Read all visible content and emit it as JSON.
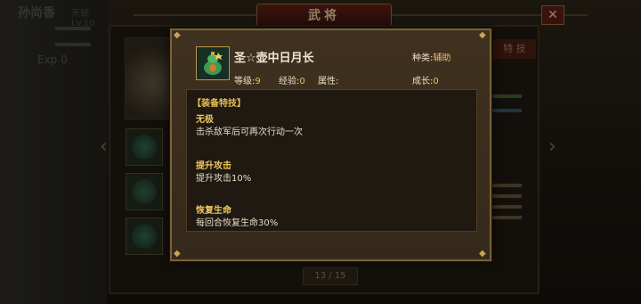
{
  "background": {
    "hero_name": "孙尚香",
    "hero_sub": "天赋 Lv.10",
    "exp_label": "Exp 0",
    "window_title": "武将",
    "close_glyph": "✕",
    "right_tab_label": "特 技",
    "page_indicator": "13 / 15",
    "arrow_left": "‹",
    "arrow_right": "›"
  },
  "popup": {
    "item_name": "圣☆壶中日月长",
    "item_icon": "gourd-icon",
    "level_label": "等级:",
    "level_value": "9",
    "exp_label": "经验:",
    "exp_value": "0",
    "attr_label": "属性:",
    "attr_value": "",
    "category_label": "种类:",
    "category_value": "辅助",
    "growth_label": "成长:",
    "growth_value": "0",
    "section_title": "【装备特技】",
    "skills": [
      {
        "name": "无极",
        "desc": "击杀敌军后可再次行动一次"
      },
      {
        "name": "提升攻击",
        "desc": "提升攻击10%"
      },
      {
        "name": "恢复生命",
        "desc": "每回合恢复生命30%"
      }
    ]
  },
  "colors": {
    "accent_gold": "#e8bf55",
    "value_gold": "#e8c060",
    "frame": "#7a6138"
  }
}
